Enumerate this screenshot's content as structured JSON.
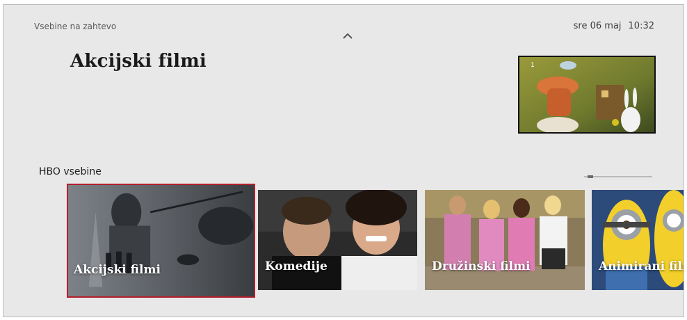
{
  "header": {
    "section": "Vsebine na zahtevo",
    "day": "sre 06 maj",
    "time": "10:32",
    "chevron_icon": "chevron-up-icon"
  },
  "page": {
    "title": "Akcijski filmi"
  },
  "preview": {
    "episode_badge": "1"
  },
  "row": {
    "label": "HBO vsebine",
    "scroll_position": 0.05,
    "tiles": [
      {
        "label": "Akcijski filmi",
        "selected": true
      },
      {
        "label": "Komedije",
        "selected": false
      },
      {
        "label": "Družinski filmi",
        "selected": false
      },
      {
        "label": "Animirani filmi",
        "selected": false
      }
    ]
  },
  "colors": {
    "background": "#e8e8e8",
    "focus_border": "#b31f2c",
    "title_text": "#1a1a1a"
  }
}
